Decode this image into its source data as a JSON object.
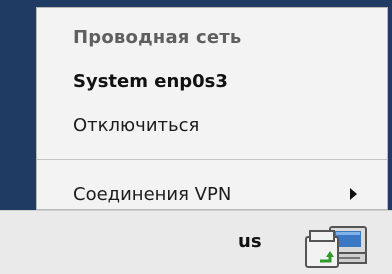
{
  "menu": {
    "header": "Проводная сеть",
    "connection": "System enp0s3",
    "disconnect": "Отключиться",
    "vpn": "Соединения VPN"
  },
  "taskbar": {
    "keyboard_layout": "us",
    "network_icon": "network-wired-icon"
  },
  "colors": {
    "menu_bg": "#f3f3f3",
    "desktop_bg": "#1f3a63",
    "taskbar_bg": "#eaeaea"
  }
}
